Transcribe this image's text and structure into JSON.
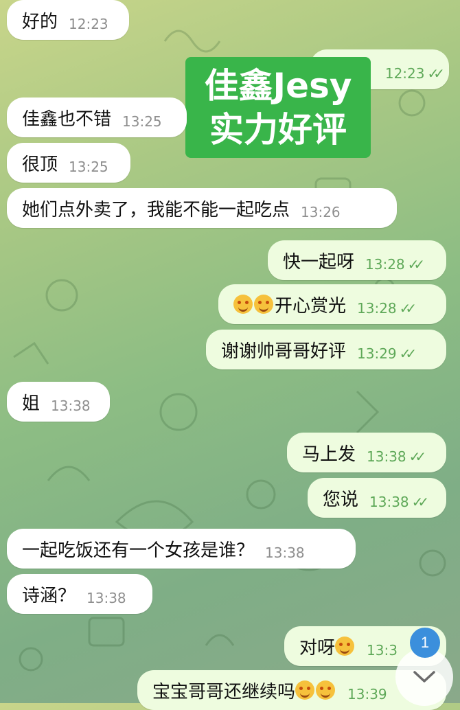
{
  "overlay": {
    "line1": "佳鑫Jesy",
    "line2": "实力好评"
  },
  "messages": [
    {
      "text": "好的",
      "time": "12:23"
    },
    {
      "text": "",
      "time": "12:23"
    },
    {
      "text": "佳鑫也不错",
      "time": "13:25"
    },
    {
      "text": "很顶",
      "time": "13:25"
    },
    {
      "text": "她们点外卖了，我能不能一起吃点",
      "time": "13:26"
    },
    {
      "text": "快一起呀",
      "time": "13:28"
    },
    {
      "text": "开心赏光",
      "time": "13:28"
    },
    {
      "text": "谢谢帅哥哥好评",
      "time": "13:29"
    },
    {
      "text": "姐",
      "time": "13:38"
    },
    {
      "text": "马上发",
      "time": "13:38"
    },
    {
      "text": "您说",
      "time": "13:38"
    },
    {
      "text": "一起吃饭还有一个女孩是谁？",
      "time": "13:38"
    },
    {
      "text": "诗涵？",
      "time": "13:38"
    },
    {
      "text": "对呀",
      "time": "13:3"
    },
    {
      "text": "宝宝哥哥还继续吗",
      "time": "13:39"
    }
  ],
  "unread_badge": "1",
  "read_mark": "✓✓",
  "icons": {
    "scroll_down": "chevron-down-icon",
    "emoji": "smiling-face-icon"
  },
  "colors": {
    "incoming": "#ffffff",
    "outgoing": "#eefcdf",
    "accent": "#5ea858",
    "badge": "#3b8fdc",
    "overlay": "#39b54a"
  }
}
